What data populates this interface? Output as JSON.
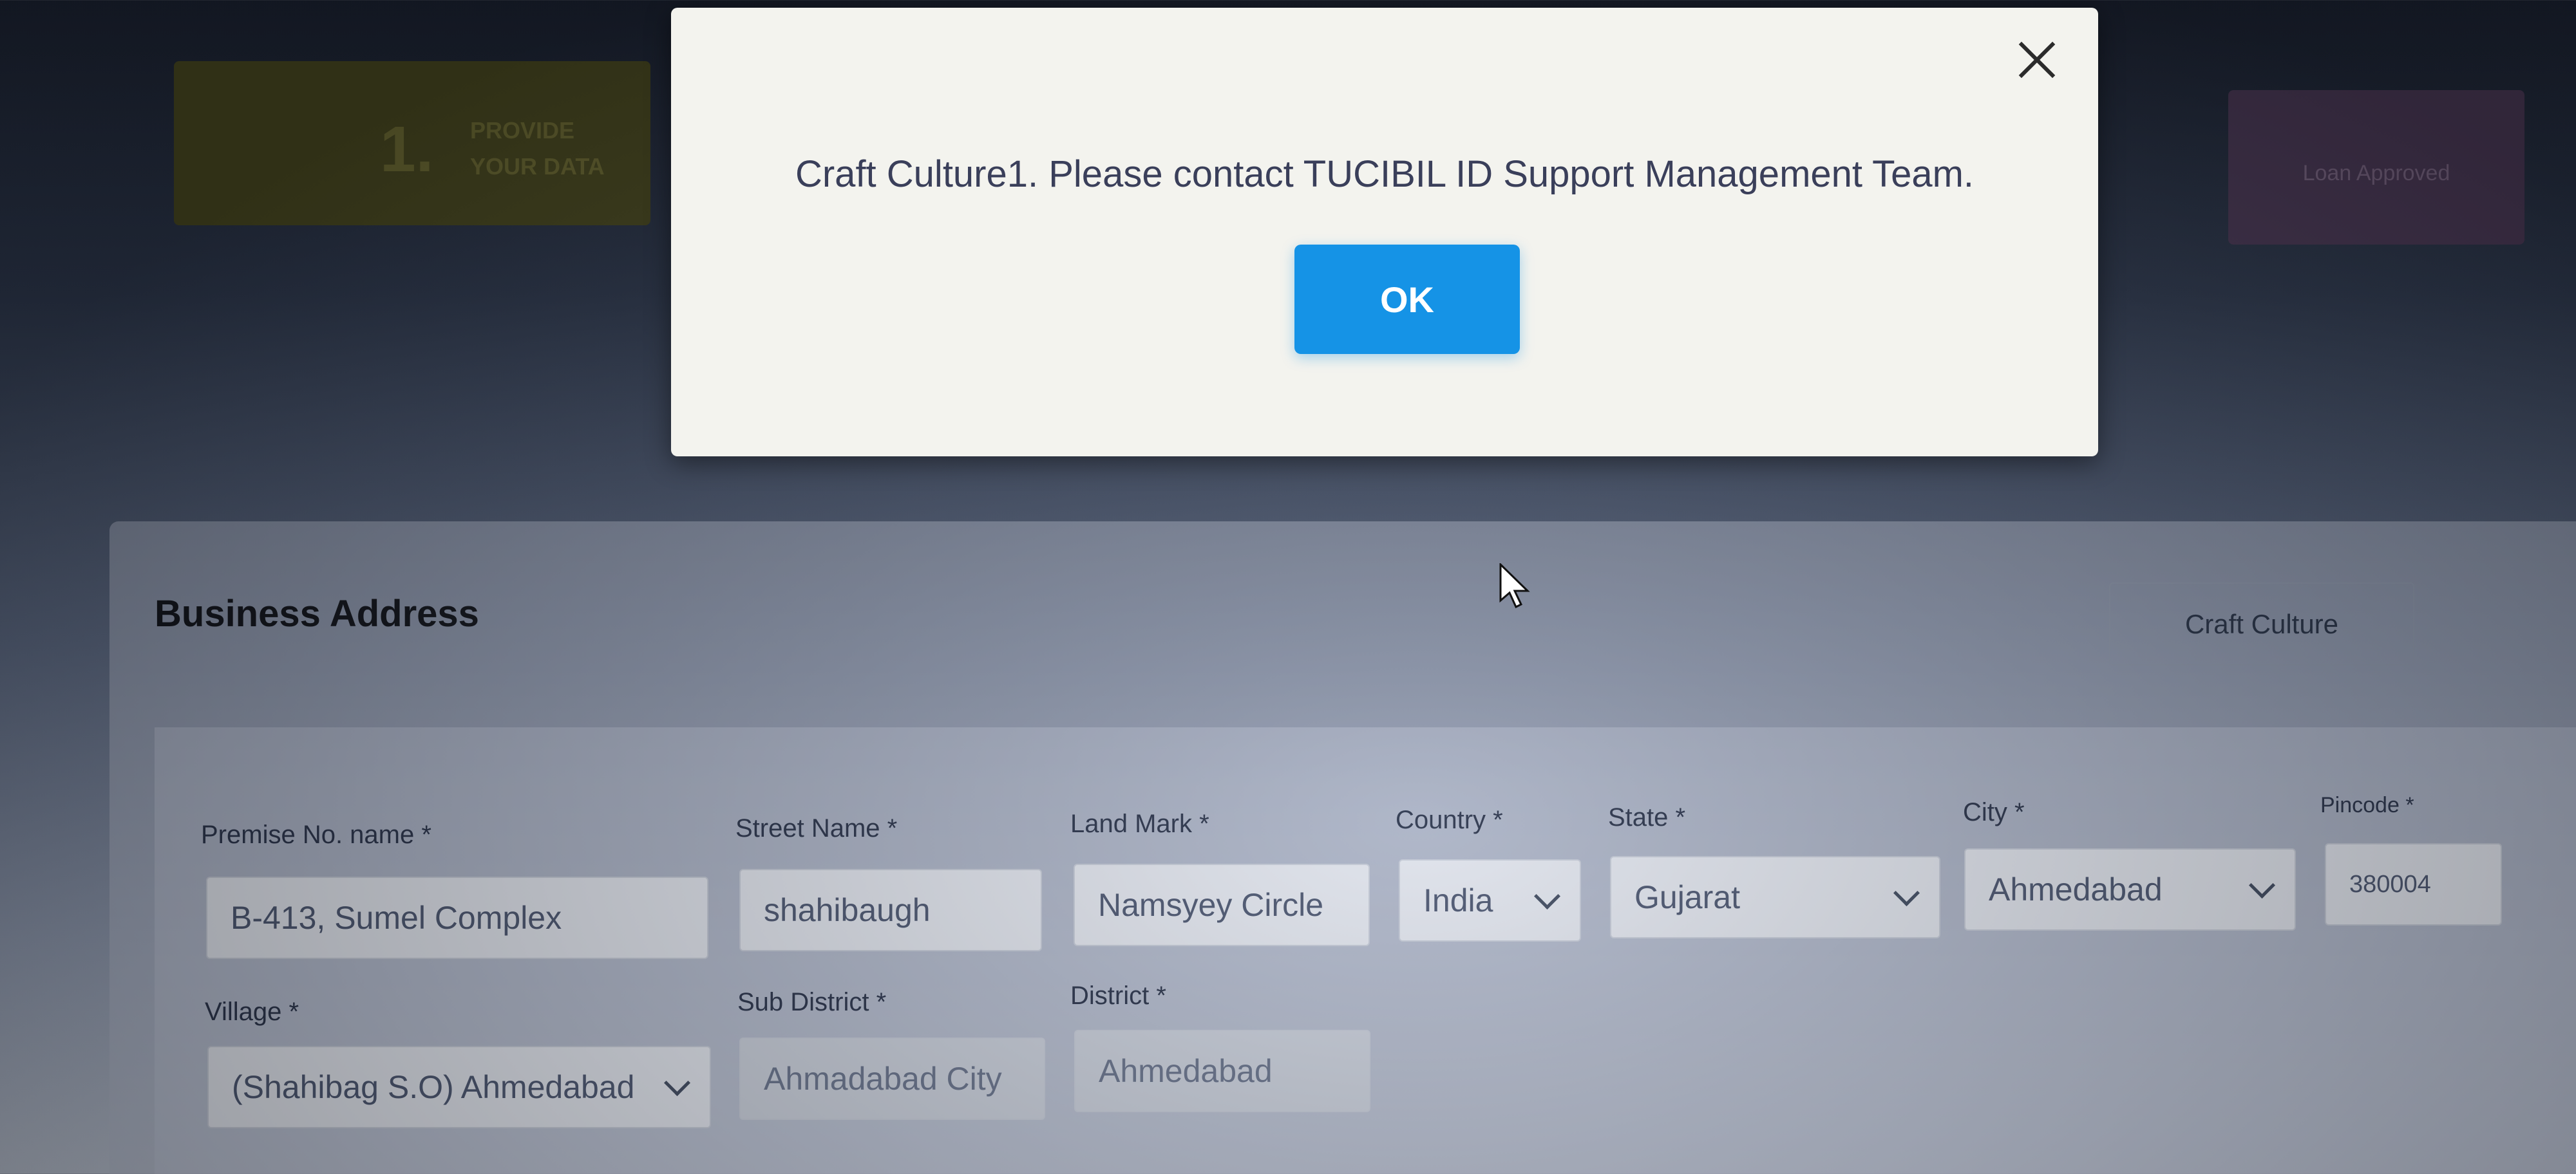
{
  "stepper": {
    "step_number": "1.",
    "step_label_line1": "PROVIDE",
    "step_label_line2": "YOUR DATA",
    "right_step_label": "Loan Approved"
  },
  "modal": {
    "message": "Craft Culture1. Please contact TUCIBIL ID Support Management Team.",
    "ok_label": "OK",
    "close_icon": "close-icon"
  },
  "section": {
    "title": "Business Address",
    "business_name": "Craft Culture"
  },
  "form": {
    "premise_label": "Premise No. name *",
    "premise_value": "B-413, Sumel Complex",
    "street_label": "Street Name *",
    "street_value": "shahibaugh",
    "landmark_label": "Land Mark *",
    "landmark_value": "Namsyey Circle",
    "country_label": "Country *",
    "country_value": "India",
    "state_label": "State *",
    "state_value": "Gujarat",
    "city_label": "City *",
    "city_value": "Ahmedabad",
    "pincode_label": "Pincode *",
    "pincode_value": "380004",
    "village_label": "Village *",
    "village_value": "(Shahibag S.O) Ahmedabad",
    "subdistrict_label": "Sub District *",
    "subdistrict_value": "Ahmadabad City",
    "district_label": "District *",
    "district_value": "Ahmedabad"
  }
}
